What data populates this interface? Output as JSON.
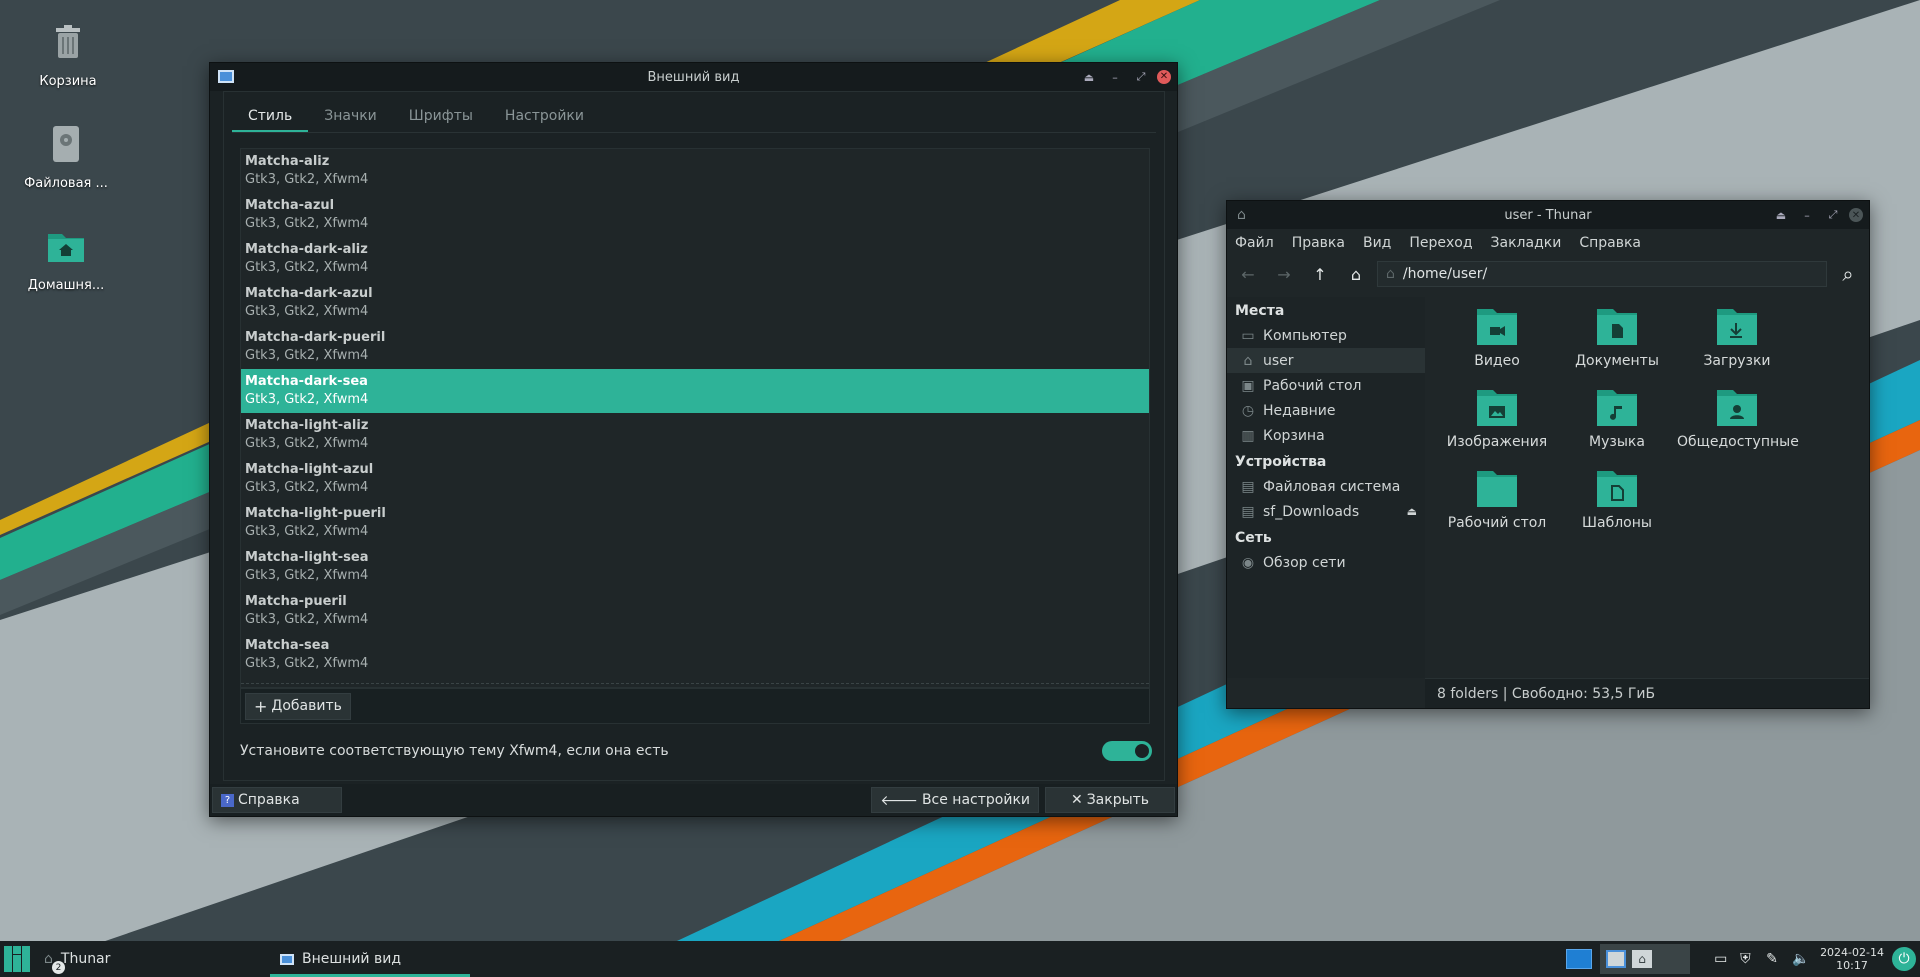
{
  "desktop": {
    "icons": [
      {
        "label": "Корзина",
        "icon": "trash-icon"
      },
      {
        "label": "Файловая ...",
        "icon": "drive-icon"
      },
      {
        "label": "Домашня...",
        "icon": "home-folder-icon"
      }
    ],
    "colors": {
      "accent": "#2eb398",
      "yellow": "#d4a615",
      "cyan": "#1aa6c2",
      "orange": "#e8650f"
    }
  },
  "appearance": {
    "title": "Внешний вид",
    "tabs": [
      "Стиль",
      "Значки",
      "Шрифты",
      "Настройки"
    ],
    "active_tab": 0,
    "themes": [
      {
        "name": "Matcha-aliz",
        "sub": "Gtk3, Gtk2, Xfwm4"
      },
      {
        "name": "Matcha-azul",
        "sub": "Gtk3, Gtk2, Xfwm4"
      },
      {
        "name": "Matcha-dark-aliz",
        "sub": "Gtk3, Gtk2, Xfwm4"
      },
      {
        "name": "Matcha-dark-azul",
        "sub": "Gtk3, Gtk2, Xfwm4"
      },
      {
        "name": "Matcha-dark-pueril",
        "sub": "Gtk3, Gtk2, Xfwm4"
      },
      {
        "name": "Matcha-dark-sea",
        "sub": "Gtk3, Gtk2, Xfwm4",
        "selected": true
      },
      {
        "name": "Matcha-light-aliz",
        "sub": "Gtk3, Gtk2, Xfwm4"
      },
      {
        "name": "Matcha-light-azul",
        "sub": "Gtk3, Gtk2, Xfwm4"
      },
      {
        "name": "Matcha-light-pueril",
        "sub": "Gtk3, Gtk2, Xfwm4"
      },
      {
        "name": "Matcha-light-sea",
        "sub": "Gtk3, Gtk2, Xfwm4"
      },
      {
        "name": "Matcha-pueril",
        "sub": "Gtk3, Gtk2, Xfwm4"
      },
      {
        "name": "Matcha-sea",
        "sub": "Gtk3, Gtk2, Xfwm4"
      }
    ],
    "add_label": "Добавить",
    "xfwm_checkbox_label": "Установите соответствующую тему Xfwm4, если она есть",
    "xfwm_checkbox_on": true,
    "help_label": "Справка",
    "all_settings_label": "Все настройки",
    "close_label": "Закрыть"
  },
  "thunar": {
    "title": "user - Thunar",
    "menu": [
      "Файл",
      "Правка",
      "Вид",
      "Переход",
      "Закладки",
      "Справка"
    ],
    "path": "/home/user/",
    "sidebar": {
      "places_header": "Места",
      "places": [
        {
          "label": "Компьютер",
          "icon": "computer-icon"
        },
        {
          "label": "user",
          "icon": "home-icon",
          "selected": true
        },
        {
          "label": "Рабочий стол",
          "icon": "desktop-icon"
        },
        {
          "label": "Недавние",
          "icon": "clock-icon"
        },
        {
          "label": "Корзина",
          "icon": "trash-icon"
        }
      ],
      "devices_header": "Устройства",
      "devices": [
        {
          "label": "Файловая система",
          "icon": "drive-icon"
        },
        {
          "label": "sf_Downloads",
          "icon": "drive-icon",
          "eject": true
        }
      ],
      "network_header": "Сеть",
      "network": [
        {
          "label": "Обзор сети",
          "icon": "network-icon"
        }
      ]
    },
    "folders": [
      {
        "label": "Видео",
        "icon": "video-folder-icon"
      },
      {
        "label": "Документы",
        "icon": "documents-folder-icon"
      },
      {
        "label": "Загрузки",
        "icon": "downloads-folder-icon"
      },
      {
        "label": "Изображения",
        "icon": "pictures-folder-icon"
      },
      {
        "label": "Музыка",
        "icon": "music-folder-icon"
      },
      {
        "label": "Общедоступные",
        "icon": "public-folder-icon"
      },
      {
        "label": "Рабочий стол",
        "icon": "desktop-folder-icon"
      },
      {
        "label": "Шаблоны",
        "icon": "templates-folder-icon"
      }
    ],
    "status": "8 folders  |  Свободно: 53,5 ГиБ"
  },
  "taskbar": {
    "tasks": [
      {
        "label": "Thunar",
        "badge": "2"
      },
      {
        "label": "Внешний вид",
        "active": true
      }
    ],
    "date": "2024-02-14",
    "time": "10:17"
  }
}
